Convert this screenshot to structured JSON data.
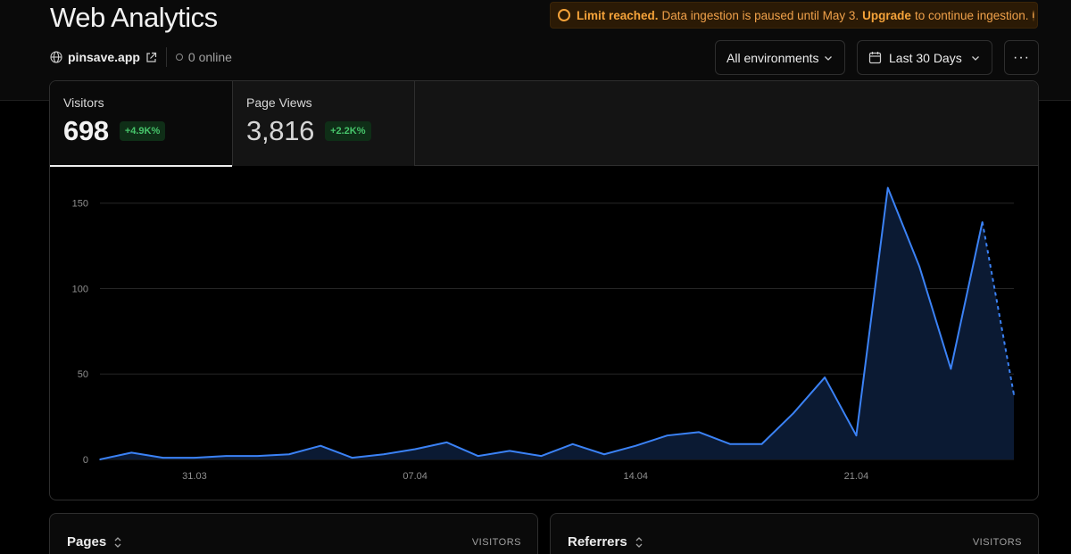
{
  "header": {
    "title": "Web Analytics",
    "site": "pinsave.app",
    "online": "0 online"
  },
  "banner": {
    "strong": "Limit reached.",
    "text": "Data ingestion is paused until May 3.",
    "link": "Upgrade",
    "text_after": "to continue ingestion.",
    "info": "i"
  },
  "controls": {
    "environment": "All environments",
    "range": "Last 30 Days",
    "more": "···"
  },
  "tabs": [
    {
      "label": "Visitors",
      "value": "698",
      "delta": "+4.9K%"
    },
    {
      "label": "Page Views",
      "value": "3,816",
      "delta": "+2.2K%"
    }
  ],
  "chart_data": {
    "type": "area",
    "series": [
      {
        "values": [
          0,
          4,
          1,
          1,
          2,
          2,
          3,
          8,
          1,
          3,
          6,
          10,
          2,
          5,
          2,
          9,
          3,
          8,
          14,
          16,
          9,
          9,
          27,
          48,
          14,
          159,
          113,
          53,
          139,
          38
        ]
      }
    ],
    "x_ticks": [
      {
        "index": 3,
        "label": "31.03"
      },
      {
        "index": 10,
        "label": "07.04"
      },
      {
        "index": 17,
        "label": "14.04"
      },
      {
        "index": 24,
        "label": "21.04"
      }
    ],
    "y_ticks": [
      0,
      50,
      100,
      150
    ],
    "ylim": [
      0,
      165
    ],
    "dashed_from_index": 28,
    "grid": true,
    "colors": {
      "line": "#3b82f6",
      "fill": "#0b1a33",
      "grid": "#262626",
      "tick": "#8f8f8f"
    }
  },
  "panels": {
    "pages": {
      "title": "Pages",
      "column": "VISITORS"
    },
    "referrers": {
      "title": "Referrers",
      "column": "VISITORS"
    }
  }
}
